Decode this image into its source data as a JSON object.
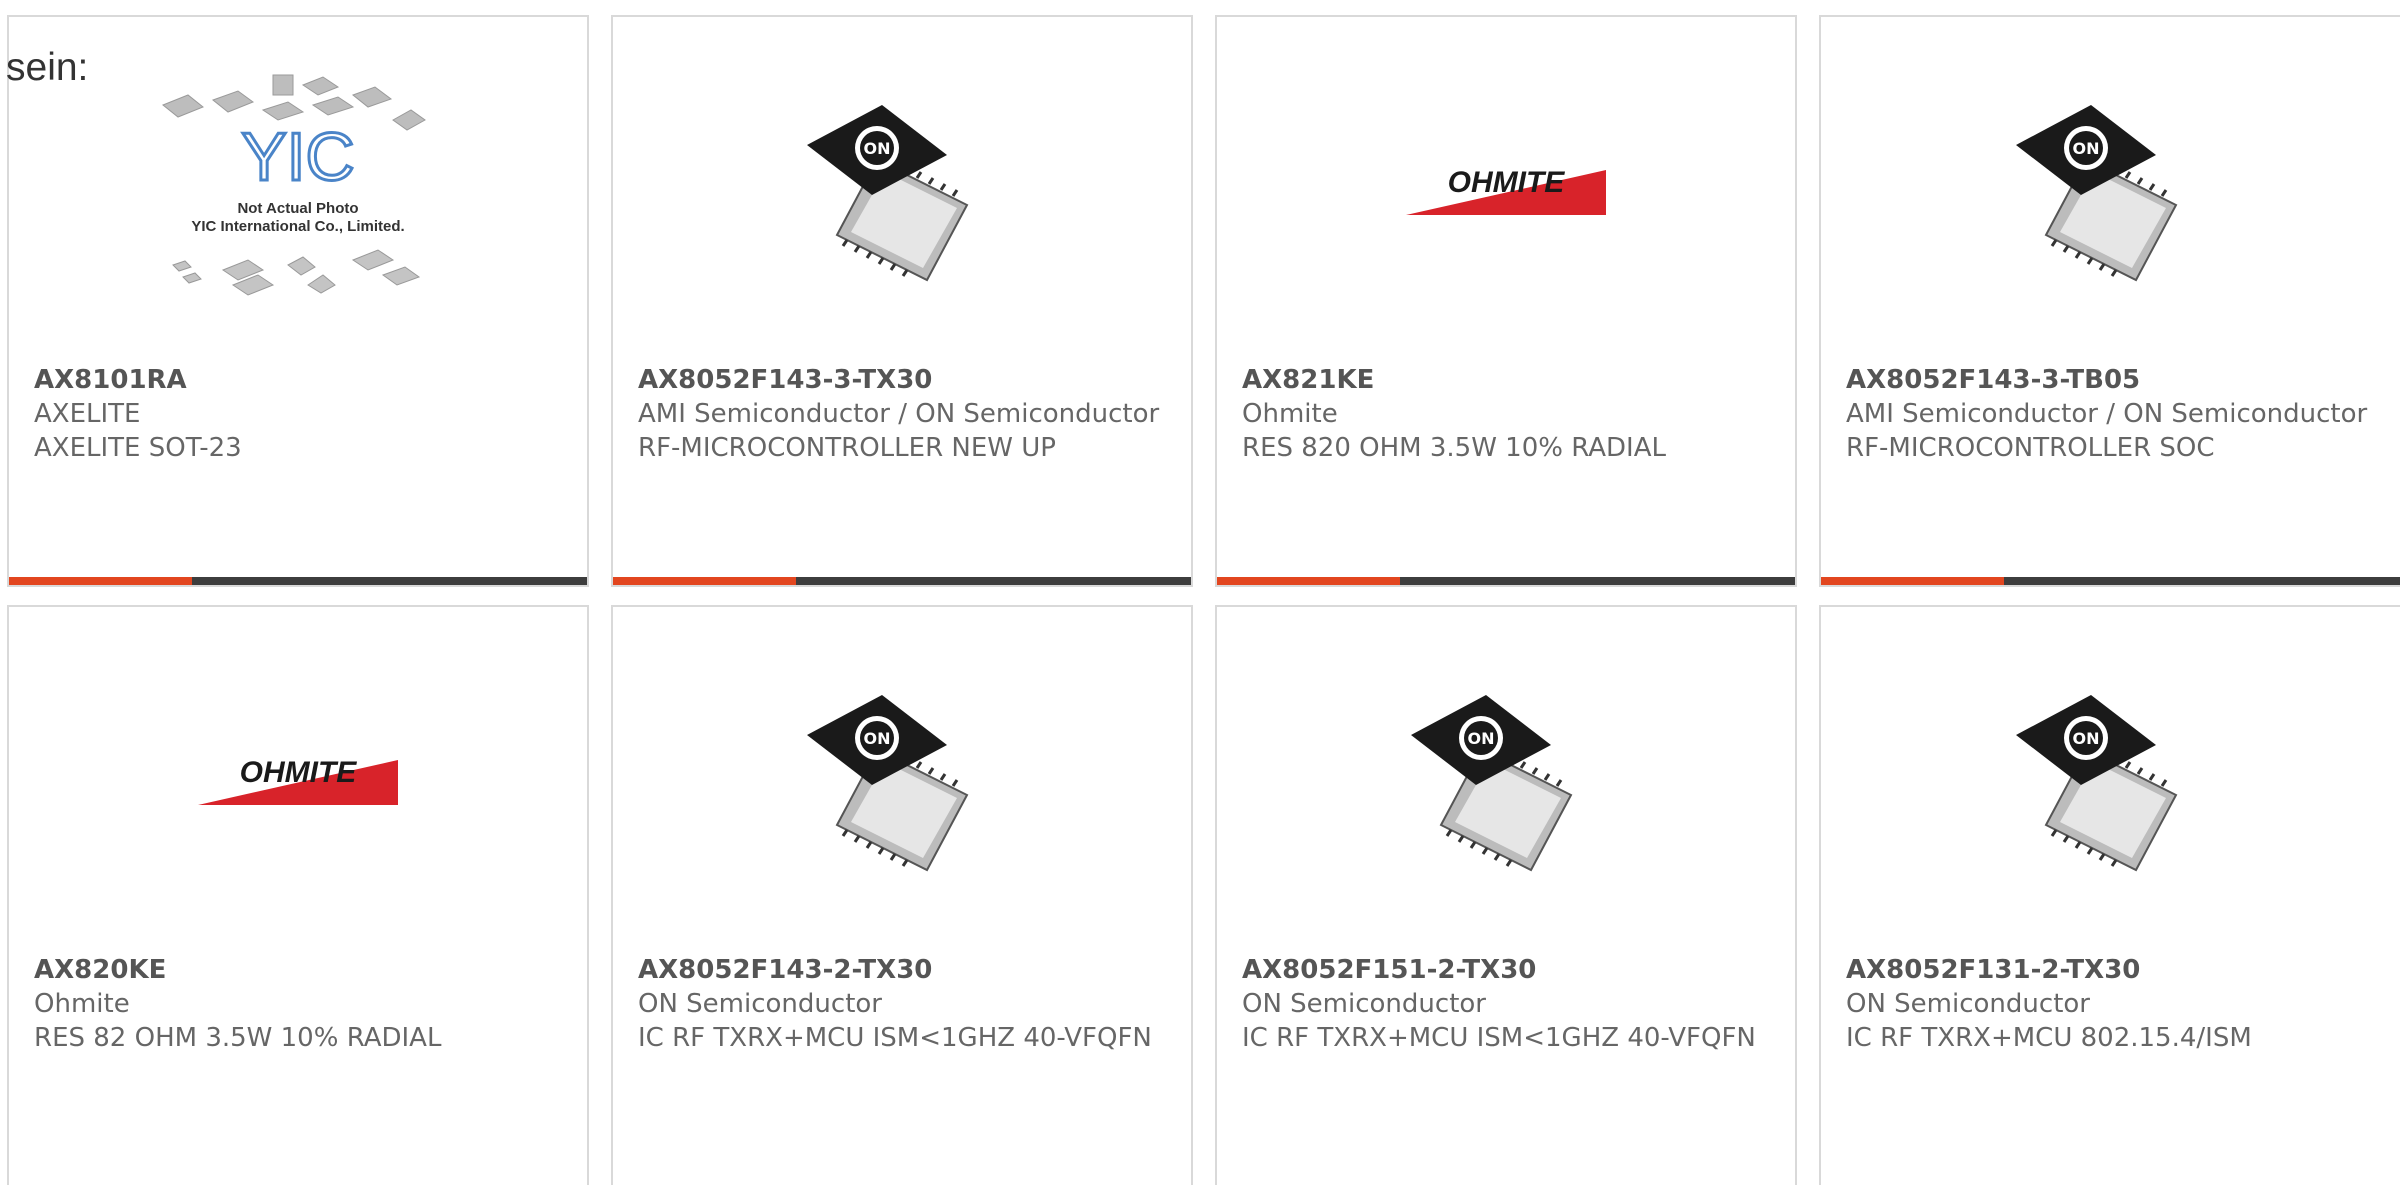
{
  "header": {
    "fragment_text": "sein:"
  },
  "products": [
    {
      "part_number": "AX8101RA",
      "manufacturer": "AXELITE",
      "description": "AXELITE SOT-23",
      "image": "yic-not-actual-photo",
      "image_caption_line1": "Not Actual Photo",
      "image_caption_line2": "YIC International Co., Limited.",
      "image_logo_text": "YIC"
    },
    {
      "part_number": "AX8052F143-3-TX30",
      "manufacturer": "AMI Semiconductor / ON Semiconductor",
      "description": "RF-MICROCONTROLLER NEW UP",
      "image": "on-semiconductor-chip",
      "image_logo_text": "ON"
    },
    {
      "part_number": "AX821KE",
      "manufacturer": "Ohmite",
      "description": "RES 820 OHM 3.5W 10% RADIAL",
      "image": "ohmite-logo",
      "image_logo_text": "OHMITE"
    },
    {
      "part_number": "AX8052F143-3-TB05",
      "manufacturer": "AMI Semiconductor / ON Semiconductor",
      "description": "RF-MICROCONTROLLER SOC",
      "image": "on-semiconductor-chip",
      "image_logo_text": "ON"
    },
    {
      "part_number": "AX820KE",
      "manufacturer": "Ohmite",
      "description": "RES 82 OHM 3.5W 10% RADIAL",
      "image": "ohmite-logo",
      "image_logo_text": "OHMITE"
    },
    {
      "part_number": "AX8052F143-2-TX30",
      "manufacturer": "ON Semiconductor",
      "description": "IC RF TXRX+MCU ISM<1GHZ 40-VFQFN",
      "image": "on-semiconductor-chip",
      "image_logo_text": "ON"
    },
    {
      "part_number": "AX8052F151-2-TX30",
      "manufacturer": "ON Semiconductor",
      "description": "IC RF TXRX+MCU ISM<1GHZ 40-VFQFN",
      "image": "on-semiconductor-chip",
      "image_logo_text": "ON"
    },
    {
      "part_number": "AX8052F131-2-TX30",
      "manufacturer": "ON Semiconductor",
      "description": "IC RF TXRX+MCU 802.15.4/ISM",
      "image": "on-semiconductor-chip",
      "image_logo_text": "ON"
    }
  ],
  "colors": {
    "accent": "#e2461f",
    "bar": "#3d3d3d",
    "border": "#d9d9d9",
    "ohmite_red": "#d8232a"
  }
}
